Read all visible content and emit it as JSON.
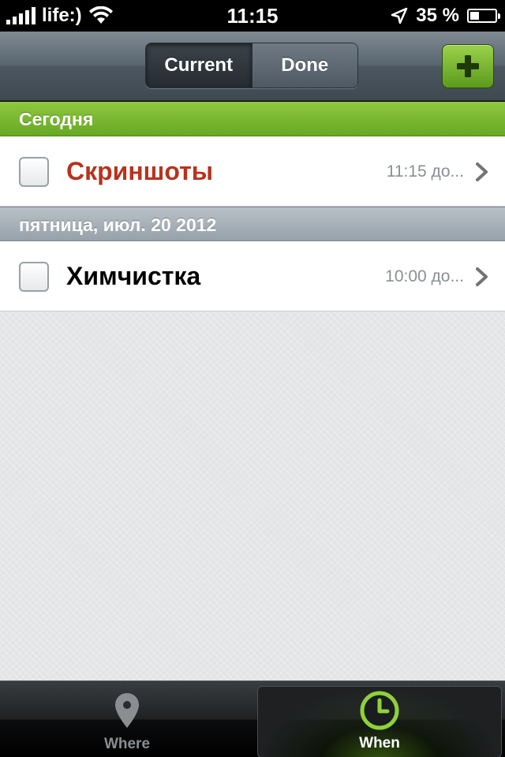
{
  "status_bar": {
    "carrier": "life:)",
    "time": "11:15",
    "battery_percent_text": "35 %",
    "battery_level": 0.35,
    "signal_bars": 5
  },
  "nav": {
    "segments": [
      {
        "label": "Current",
        "selected": true
      },
      {
        "label": "Done",
        "selected": false
      }
    ],
    "add_icon": "plus-icon"
  },
  "sections": [
    {
      "header": "Сегодня",
      "style": "green",
      "tasks": [
        {
          "title": "Скриншоты",
          "time": "11:15 до...",
          "overdue": true
        }
      ]
    },
    {
      "header": "пятница, июл. 20 2012",
      "style": "gray",
      "tasks": [
        {
          "title": "Химчистка",
          "time": "10:00 до...",
          "overdue": false
        }
      ]
    }
  ],
  "tab_bar": {
    "tabs": [
      {
        "label": "Where",
        "icon": "location-pin-icon",
        "selected": false
      },
      {
        "label": "When",
        "icon": "clock-icon",
        "selected": true
      }
    ]
  },
  "colors": {
    "accent_green": "#7cbb32",
    "overdue_red": "#b8321d"
  }
}
